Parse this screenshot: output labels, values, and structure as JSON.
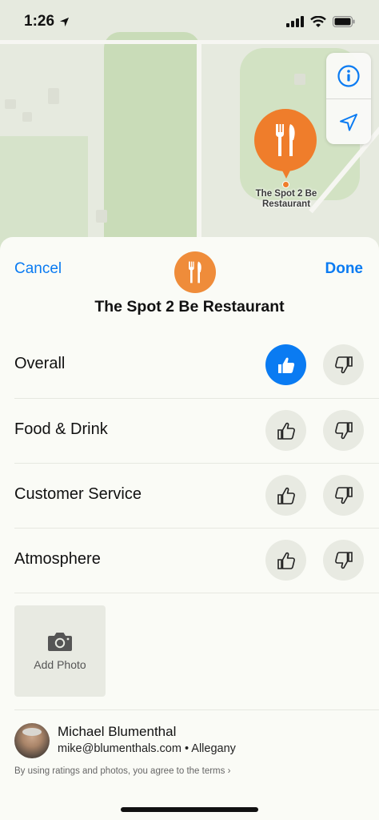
{
  "status_bar": {
    "time": "1:26"
  },
  "map": {
    "pin_label": "The Spot 2 Be Restaurant"
  },
  "sheet": {
    "cancel_label": "Cancel",
    "done_label": "Done",
    "title": "The Spot 2 Be Restaurant",
    "ratings": [
      {
        "label": "Overall",
        "selected": "up"
      },
      {
        "label": "Food & Drink",
        "selected": "none"
      },
      {
        "label": "Customer Service",
        "selected": "none"
      },
      {
        "label": "Atmosphere",
        "selected": "none"
      }
    ],
    "add_photo_label": "Add Photo",
    "user": {
      "name": "Michael Blumenthal",
      "meta": "mike@blumenthals.com • Allegany"
    },
    "terms_text": "By using ratings and photos, you agree to the terms ›"
  },
  "colors": {
    "accent": "#0a7bf2",
    "restaurant": "#ef7d2b"
  }
}
